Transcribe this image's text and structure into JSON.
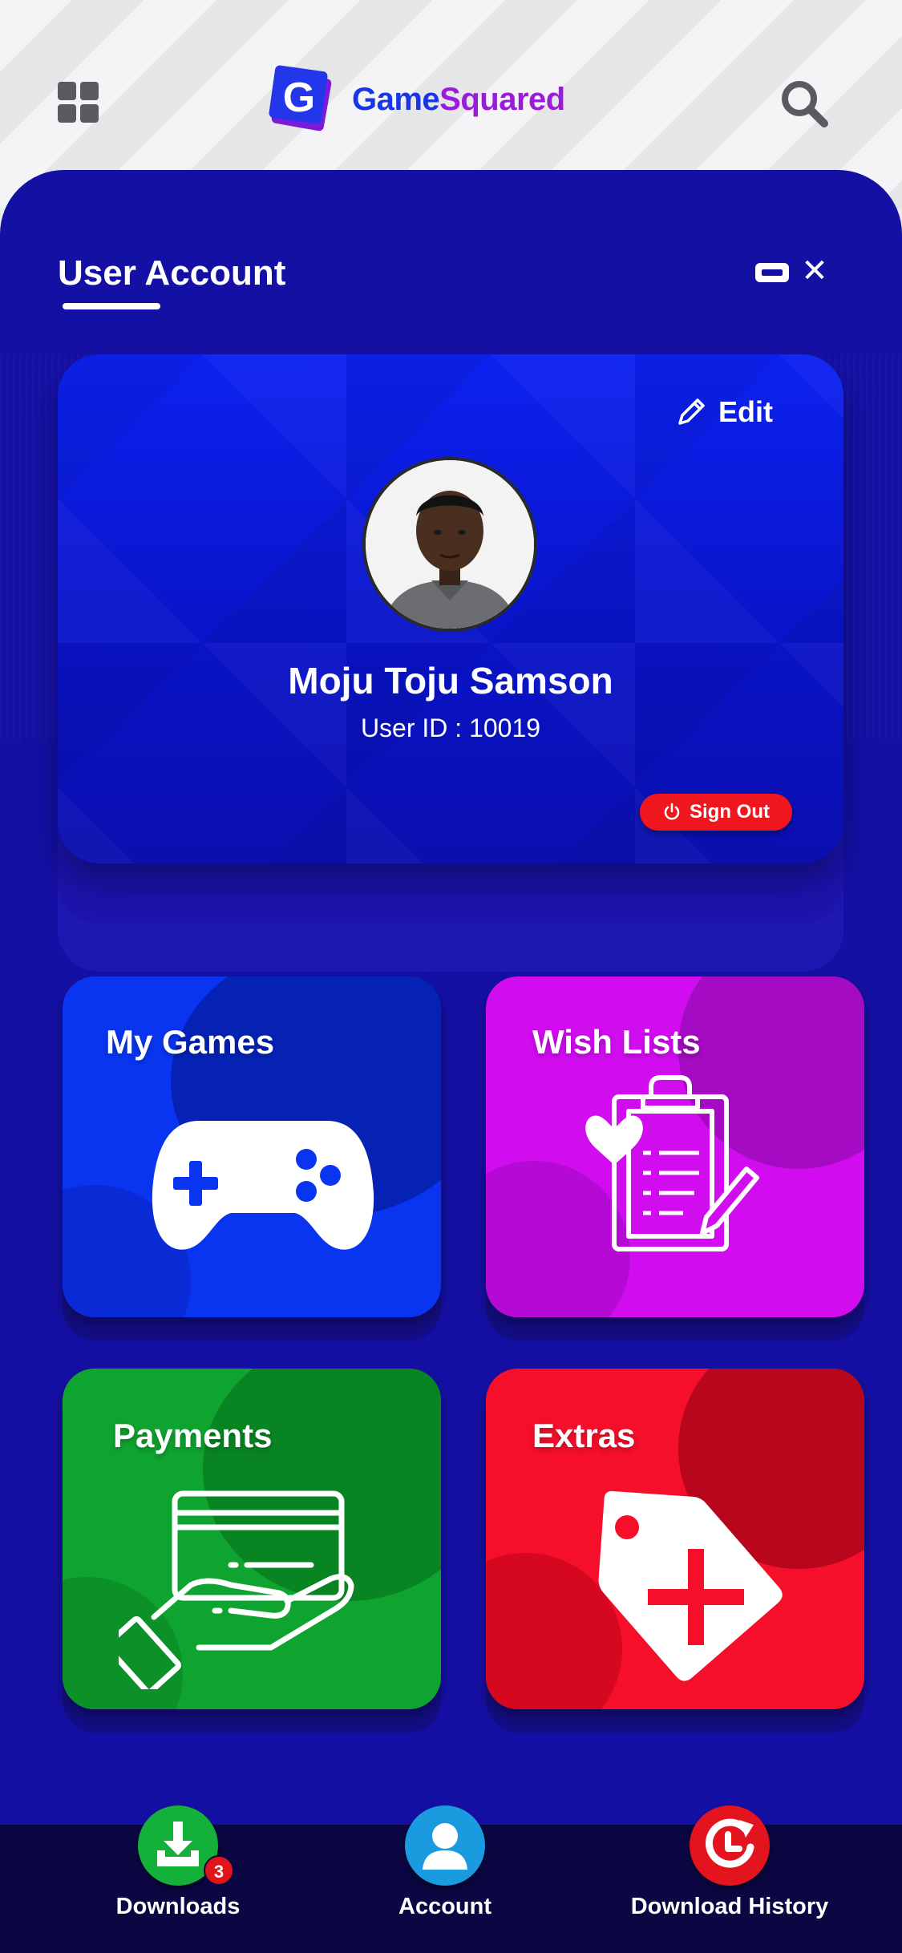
{
  "header": {
    "brand_part1": "Game",
    "brand_part2": "Squared",
    "logo_letter": "G"
  },
  "section": {
    "title": "User Account"
  },
  "profile": {
    "edit_label": "Edit",
    "name": "Moju Toju Samson",
    "user_id": "User ID : 10019",
    "sign_out_label": "Sign Out"
  },
  "tiles": [
    {
      "label": "My Games",
      "color": "#0a35f0"
    },
    {
      "label": "Wish Lists",
      "color": "#d10df0"
    },
    {
      "label": "Payments",
      "color": "#0fa32f"
    },
    {
      "label": "Extras",
      "color": "#f50f2b"
    }
  ],
  "bottom_nav": {
    "items": [
      {
        "label": "Downloads",
        "icon": "download-icon",
        "badge": "3",
        "color": "#13b03a"
      },
      {
        "label": "Account",
        "icon": "user-icon",
        "color": "#1a9be0"
      },
      {
        "label": "Download History",
        "icon": "history-icon",
        "color": "#e3141e"
      }
    ]
  },
  "colors": {
    "panel": "#1510a4",
    "accent_blue": "#1a35e6",
    "accent_purple": "#9b1bdc",
    "sign_out": "#f01620"
  }
}
